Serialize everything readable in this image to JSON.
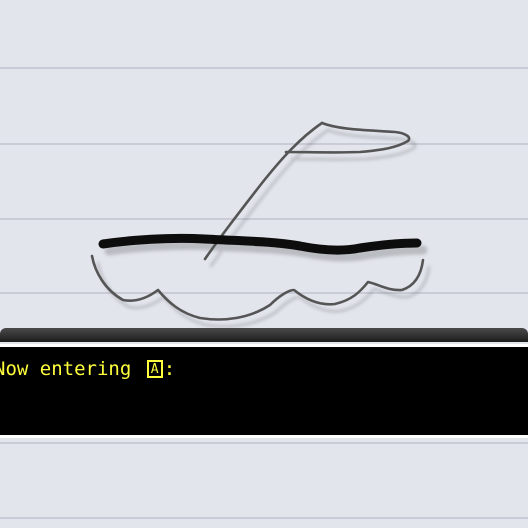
{
  "scene": {
    "background_color": "#e2e5ec",
    "rule_color": "#c9ccd6",
    "stroke_color": "#555555",
    "hull_color": "#111111"
  },
  "dialog": {
    "prefix": "Now entering ",
    "key_glyph": "A",
    "suffix": ":",
    "text_color": "#ffff3c"
  }
}
